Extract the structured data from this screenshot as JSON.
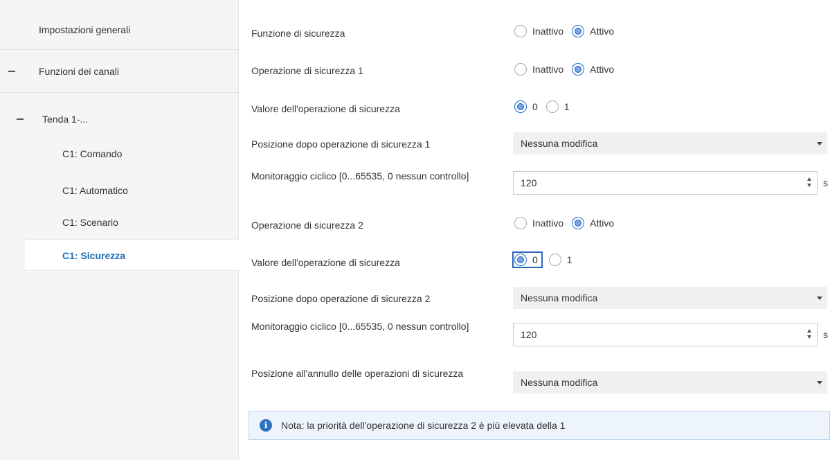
{
  "sidebar": {
    "general": "Impostazioni generali",
    "canali": "Funzioni dei canali",
    "tenda": "Tenda 1-...",
    "items": [
      {
        "label": "C1: Comando"
      },
      {
        "label": "C1: Automatico"
      },
      {
        "label": "C1: Scenario"
      },
      {
        "label": "C1: Sicurezza",
        "selected": true
      }
    ]
  },
  "form": {
    "funzione_sicurezza": {
      "label": "Funzione di sicurezza",
      "options": [
        "Inattivo",
        "Attivo"
      ],
      "selected": "Attivo"
    },
    "operazione_1": {
      "label": "Operazione di sicurezza 1",
      "options": [
        "Inattivo",
        "Attivo"
      ],
      "selected": "Attivo"
    },
    "valore_1": {
      "label": "Valore dell'operazione di sicurezza",
      "options": [
        "0",
        "1"
      ],
      "selected": "0"
    },
    "posizione_1": {
      "label": "Posizione dopo operazione di sicurezza 1",
      "value": "Nessuna modifica"
    },
    "monitoraggio_1": {
      "label": "Monitoraggio ciclico [0...65535, 0 nessun controllo]",
      "value": "120",
      "unit": "s"
    },
    "operazione_2": {
      "label": "Operazione di sicurezza 2",
      "options": [
        "Inattivo",
        "Attivo"
      ],
      "selected": "Attivo"
    },
    "valore_2": {
      "label": "Valore dell'operazione di sicurezza",
      "options": [
        "0",
        "1"
      ],
      "selected": "0"
    },
    "posizione_2": {
      "label": "Posizione dopo operazione di sicurezza 2",
      "value": "Nessuna modifica"
    },
    "monitoraggio_2": {
      "label": "Monitoraggio ciclico [0...65535, 0 nessun controllo]",
      "value": "120",
      "unit": "s"
    },
    "annullo": {
      "label": "Posizione all'annullo delle operazioni di sicurezza",
      "value": "Nessuna modifica"
    }
  },
  "note": {
    "icon": "info-icon",
    "text": "Nota: la priorità dell'operazione di sicurezza 2 è più elevata della 1"
  },
  "colors": {
    "accent": "#1a6fb5",
    "radio_checked": "#7aa6e0",
    "note_bg": "#eef4fb"
  }
}
